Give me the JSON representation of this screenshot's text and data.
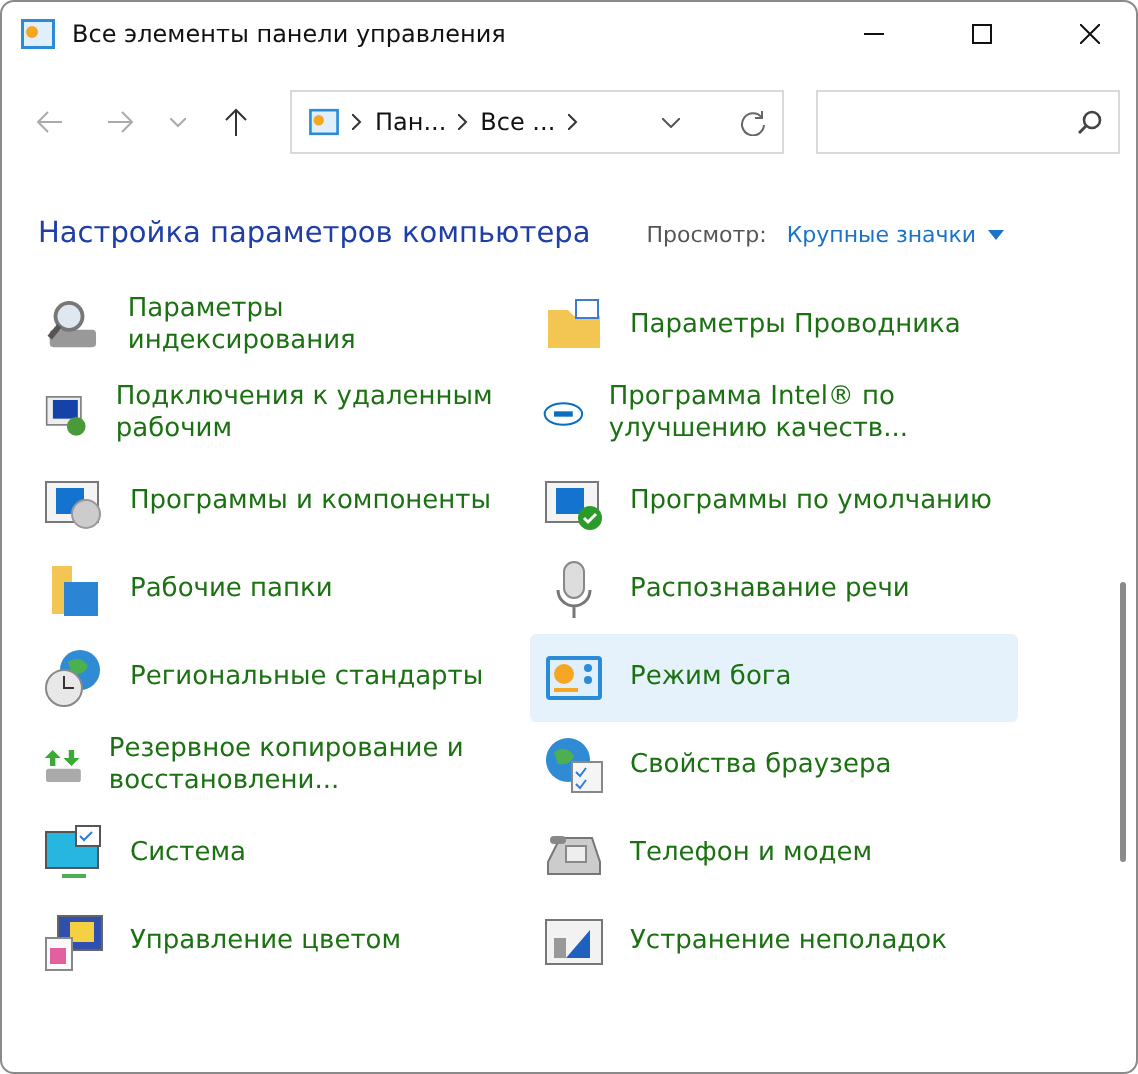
{
  "window": {
    "title": "Все элементы панели управления"
  },
  "breadcrumb": [
    "Пан...",
    "Все ..."
  ],
  "header": {
    "title": "Настройка параметров компьютера",
    "view_label": "Просмотр:",
    "view_value": "Крупные значки"
  },
  "items": [
    {
      "label": "Параметры индексирования",
      "kind": "index",
      "selected": false
    },
    {
      "label": "Параметры Проводника",
      "kind": "folder",
      "selected": false
    },
    {
      "label": "Подключения к удаленным рабочим",
      "kind": "remote",
      "selected": false
    },
    {
      "label": "Программа Intel® по улучшению качеств...",
      "kind": "intel",
      "selected": false
    },
    {
      "label": "Программы и компоненты",
      "kind": "programs",
      "selected": false
    },
    {
      "label": "Программы по умолчанию",
      "kind": "defaults",
      "selected": false
    },
    {
      "label": "Рабочие папки",
      "kind": "workfolders",
      "selected": false
    },
    {
      "label": "Распознавание речи",
      "kind": "mic",
      "selected": false
    },
    {
      "label": "Региональные стандарты",
      "kind": "region",
      "selected": false
    },
    {
      "label": "Режим бога",
      "kind": "god",
      "selected": true
    },
    {
      "label": "Резервное копирование и восстановлени...",
      "kind": "backup",
      "selected": false
    },
    {
      "label": "Свойства браузера",
      "kind": "browser",
      "selected": false
    },
    {
      "label": "Система",
      "kind": "system",
      "selected": false
    },
    {
      "label": "Телефон и модем",
      "kind": "phone",
      "selected": false
    },
    {
      "label": "Управление цветом",
      "kind": "color",
      "selected": false
    },
    {
      "label": "Устранение неполадок",
      "kind": "trouble",
      "selected": false
    }
  ]
}
